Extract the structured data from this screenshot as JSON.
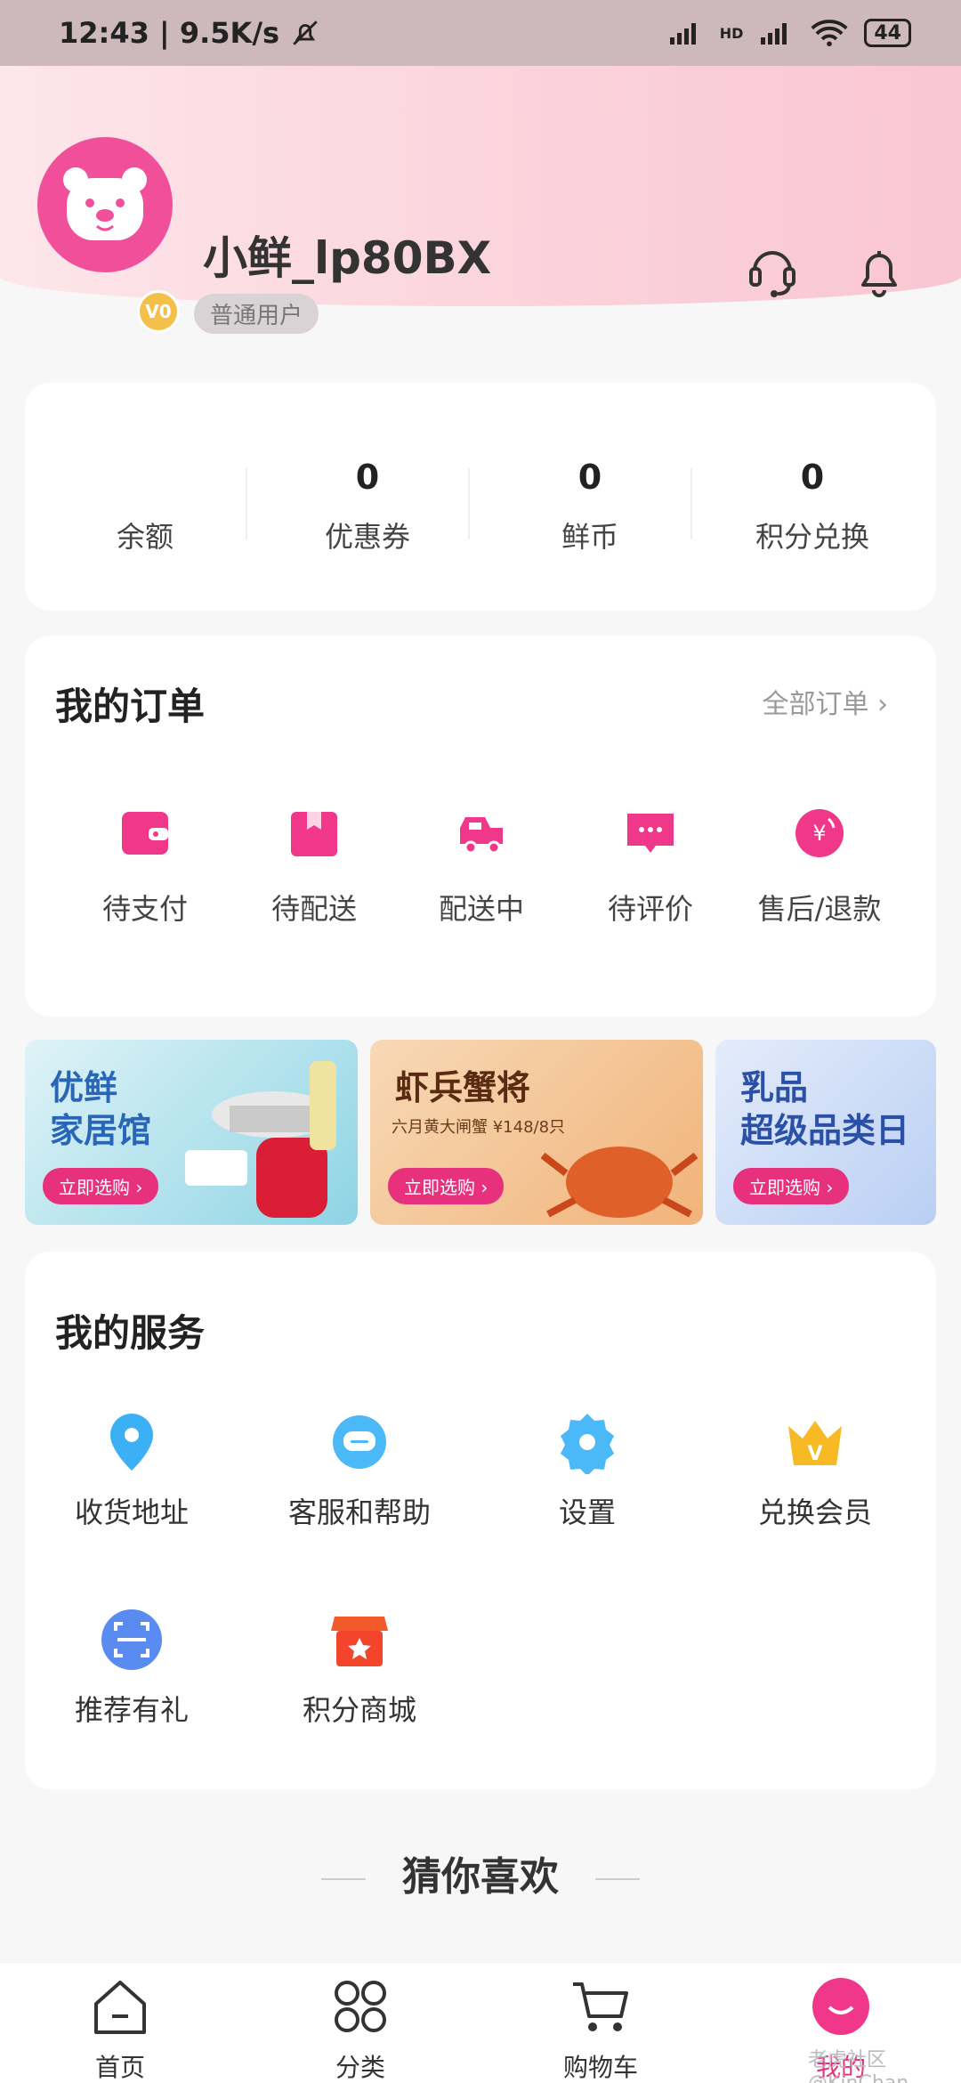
{
  "status_bar": {
    "time": "12:43 | 9.5K/s",
    "battery": "44",
    "network": "HD"
  },
  "user": {
    "name": "小鲜_lp80BX",
    "level": "普通用户",
    "vip_badge": "V0"
  },
  "wallet": [
    {
      "label": "余额",
      "value": ""
    },
    {
      "label": "优惠券",
      "value": "0"
    },
    {
      "label": "鲜币",
      "value": "0"
    },
    {
      "label": "积分兑换",
      "value": "0"
    }
  ],
  "orders": {
    "title": "我的订单",
    "all_label": "全部订单 ›",
    "items": [
      {
        "label": "待支付",
        "icon": "wallet-icon"
      },
      {
        "label": "待配送",
        "icon": "package-icon"
      },
      {
        "label": "配送中",
        "icon": "delivery-truck-icon"
      },
      {
        "label": "待评价",
        "icon": "comment-icon"
      },
      {
        "label": "售后/退款",
        "icon": "refund-icon"
      }
    ]
  },
  "banners": [
    {
      "title_line1": "优鲜",
      "title_line2": "家居馆",
      "subtitle": "",
      "button": "立即选购 ›"
    },
    {
      "title_line1": "虾兵蟹将",
      "title_line2": "",
      "subtitle": "六月黄大闸蟹 ¥148/8只",
      "button": "立即选购 ›"
    },
    {
      "title_line1": "乳品",
      "title_line2": "超级品类日",
      "subtitle": "",
      "button": "立即选购 ›"
    }
  ],
  "services": {
    "title": "我的服务",
    "items": [
      {
        "label": "收货地址",
        "icon": "location-icon"
      },
      {
        "label": "客服和帮助",
        "icon": "customer-service-icon"
      },
      {
        "label": "设置",
        "icon": "settings-gear-icon"
      },
      {
        "label": "兑换会员",
        "icon": "vip-crown-icon"
      },
      {
        "label": "推荐有礼",
        "icon": "scan-icon"
      },
      {
        "label": "积分商城",
        "icon": "points-store-icon"
      }
    ]
  },
  "guess_title": "猜你喜欢",
  "tabbar": [
    {
      "label": "首页",
      "icon": "home-icon"
    },
    {
      "label": "分类",
      "icon": "category-icon"
    },
    {
      "label": "购物车",
      "icon": "cart-icon"
    },
    {
      "label": "我的",
      "icon": "profile-icon"
    }
  ],
  "watermark": "老虎社区 @KinChan",
  "colors": {
    "accent": "#e8317c",
    "avatar_bg": "#f24f9b",
    "header_gradient_start": "#fde6ea",
    "header_gradient_end": "#f9c6d3"
  }
}
